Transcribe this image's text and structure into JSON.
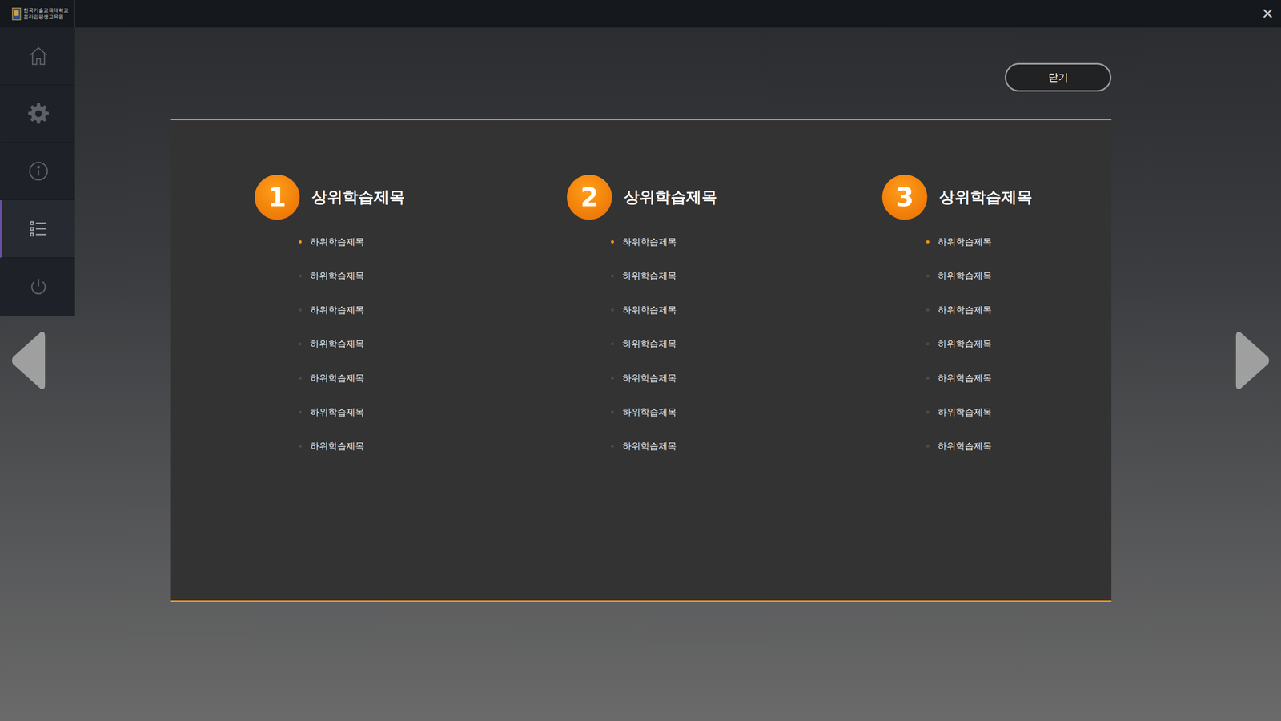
{
  "header": {
    "logo_lines": [
      "한국기술교육대학교",
      "온라인평생교육원"
    ],
    "close_icon": "✕"
  },
  "sidebar": {
    "items": [
      {
        "name": "home",
        "selected": false
      },
      {
        "name": "settings",
        "selected": false
      },
      {
        "name": "info",
        "selected": false
      },
      {
        "name": "contents",
        "selected": true
      },
      {
        "name": "power",
        "selected": false
      }
    ]
  },
  "close_button": "닫기",
  "sections": [
    {
      "number": "1",
      "title": "상위학습제목",
      "items": [
        {
          "label": "하위학습제목",
          "selected": true
        },
        {
          "label": "하위학습제목",
          "selected": false
        },
        {
          "label": "하위학습제목",
          "selected": false
        },
        {
          "label": "하위학습제목",
          "selected": false
        },
        {
          "label": "하위학습제목",
          "selected": false
        },
        {
          "label": "하위학습제목",
          "selected": false
        },
        {
          "label": "하위학습제목",
          "selected": false
        }
      ]
    },
    {
      "number": "2",
      "title": "상위학습제목",
      "items": [
        {
          "label": "하위학습제목",
          "selected": true
        },
        {
          "label": "하위학습제목",
          "selected": false
        },
        {
          "label": "하위학습제목",
          "selected": false
        },
        {
          "label": "하위학습제목",
          "selected": false
        },
        {
          "label": "하위학습제목",
          "selected": false
        },
        {
          "label": "하위학습제목",
          "selected": false
        },
        {
          "label": "하위학습제목",
          "selected": false
        }
      ]
    },
    {
      "number": "3",
      "title": "상위학습제목",
      "items": [
        {
          "label": "하위학습제목",
          "selected": true
        },
        {
          "label": "하위학습제목",
          "selected": false
        },
        {
          "label": "하위학습제목",
          "selected": false
        },
        {
          "label": "하위학습제목",
          "selected": false
        },
        {
          "label": "하위학습제목",
          "selected": false
        },
        {
          "label": "하위학습제목",
          "selected": false
        },
        {
          "label": "하위학습제목",
          "selected": false
        }
      ]
    }
  ]
}
